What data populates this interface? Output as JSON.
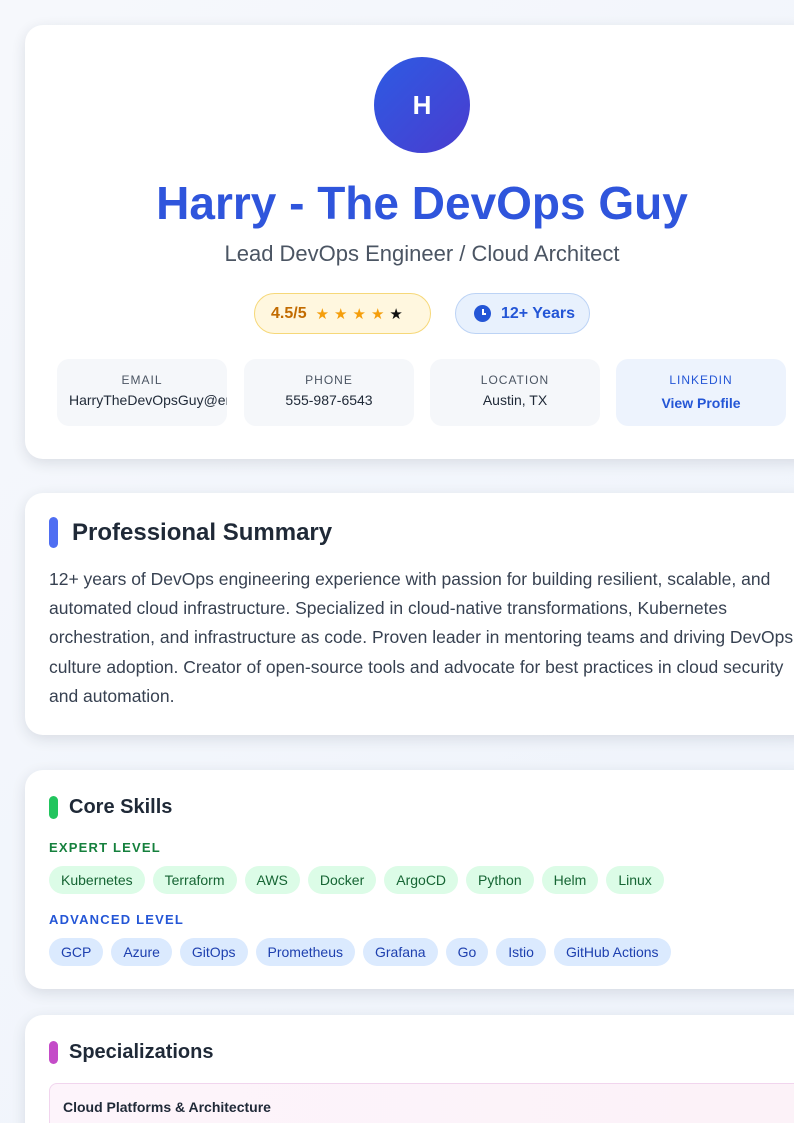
{
  "header": {
    "avatar_initial": "H",
    "name": "Harry - The DevOps Guy",
    "title": "Lead DevOps Engineer / Cloud Architect",
    "rating": {
      "value": "4.5/5",
      "stars": [
        "★",
        "★",
        "★",
        "★",
        "★"
      ],
      "score": 4.5,
      "max": 5
    },
    "experience": "12+ Years",
    "contacts": {
      "email": {
        "label": "EMAIL",
        "value": "HarryTheDevOpsGuy@email.com"
      },
      "phone": {
        "label": "PHONE",
        "value": "555-987-6543"
      },
      "location": {
        "label": "LOCATION",
        "value": "Austin, TX"
      },
      "linkedin": {
        "label": "LINKEDIN",
        "value": "View Profile"
      }
    }
  },
  "summary": {
    "heading": "Professional Summary",
    "text": "12+ years of DevOps engineering experience with passion for building resilient, scalable, and automated cloud infrastructure. Specialized in cloud-native transformations, Kubernetes orchestration, and infrastructure as code. Proven leader in mentoring teams and driving DevOps culture adoption. Creator of open-source tools and advocate for best practices in cloud security and automation."
  },
  "skills": {
    "heading": "Core Skills",
    "expert_label": "EXPERT LEVEL",
    "expert": [
      "Kubernetes",
      "Terraform",
      "AWS",
      "Docker",
      "ArgoCD",
      "Python",
      "Helm",
      "Linux"
    ],
    "advanced_label": "ADVANCED LEVEL",
    "advanced": [
      "GCP",
      "Azure",
      "GitOps",
      "Prometheus",
      "Grafana",
      "Go",
      "Istio",
      "GitHub Actions"
    ]
  },
  "specializations": {
    "heading": "Specializations",
    "first_item": "Cloud Platforms & Architecture"
  },
  "colors": {
    "accent_blue": "#2f55dc",
    "expert_green": "#15803d",
    "advanced_blue": "#2456d6",
    "specialization_purple": "#c44bc8"
  },
  "icons": {
    "experience": "clock-icon",
    "rating": "star-icon"
  }
}
